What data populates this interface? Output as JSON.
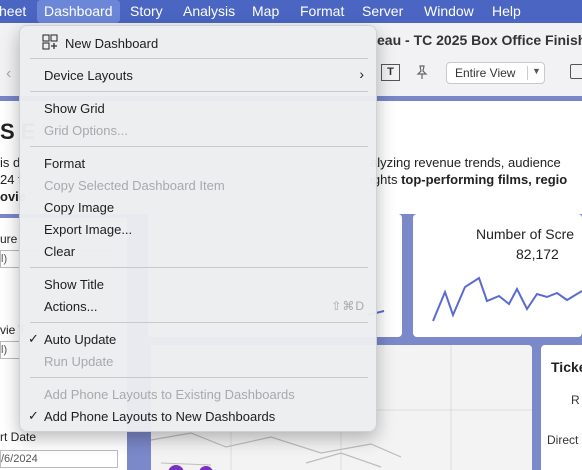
{
  "menubar": {
    "items": [
      "heet",
      "Dashboard",
      "Story",
      "Analysis",
      "Map",
      "Format",
      "Server",
      "Window",
      "Help"
    ],
    "active": "Dashboard"
  },
  "toolbar": {
    "title": "eau - TC 2025 Box Office Finishe",
    "fit_value": "Entire View",
    "text_icon_glyph": "T"
  },
  "dashboard": {
    "heading": "S E",
    "desc_left": [
      "is d",
      "24 f",
      "ovie"
    ],
    "desc_right_1": "alyzing revenue trends, audience",
    "desc_right_2_a": "ights ",
    "desc_right_2_b": "top-performing films, regio",
    "filters": {
      "label1": "ure",
      "box1": "l)",
      "label2": "vie T",
      "box2": "l)",
      "label3": "rt Date",
      "box3": "/6/2024"
    },
    "kpi": {
      "title": "Number of Scre",
      "value": "82,172"
    },
    "ticket": {
      "title": "Ticke",
      "r": "R",
      "direct": "Direct"
    }
  },
  "colors": {
    "menubar": "#4a66c2",
    "dashboard_bg": "#7b88c9",
    "accent_line": "#5a6ad0"
  },
  "menu": {
    "new_dashboard": "New Dashboard",
    "device_layouts": "Device Layouts",
    "show_grid": "Show Grid",
    "grid_options": "Grid Options...",
    "format": "Format",
    "copy_selected": "Copy Selected Dashboard Item",
    "copy_image": "Copy Image",
    "export_image": "Export Image...",
    "clear": "Clear",
    "show_title": "Show Title",
    "actions": "Actions...",
    "actions_shortcut": "⇧⌘D",
    "auto_update": "Auto Update",
    "run_update": "Run Update",
    "add_phone_existing": "Add Phone Layouts to Existing Dashboards",
    "add_phone_new": "Add Phone Layouts to New Dashboards",
    "check_glyph": "✓",
    "submenu_glyph": "›"
  }
}
